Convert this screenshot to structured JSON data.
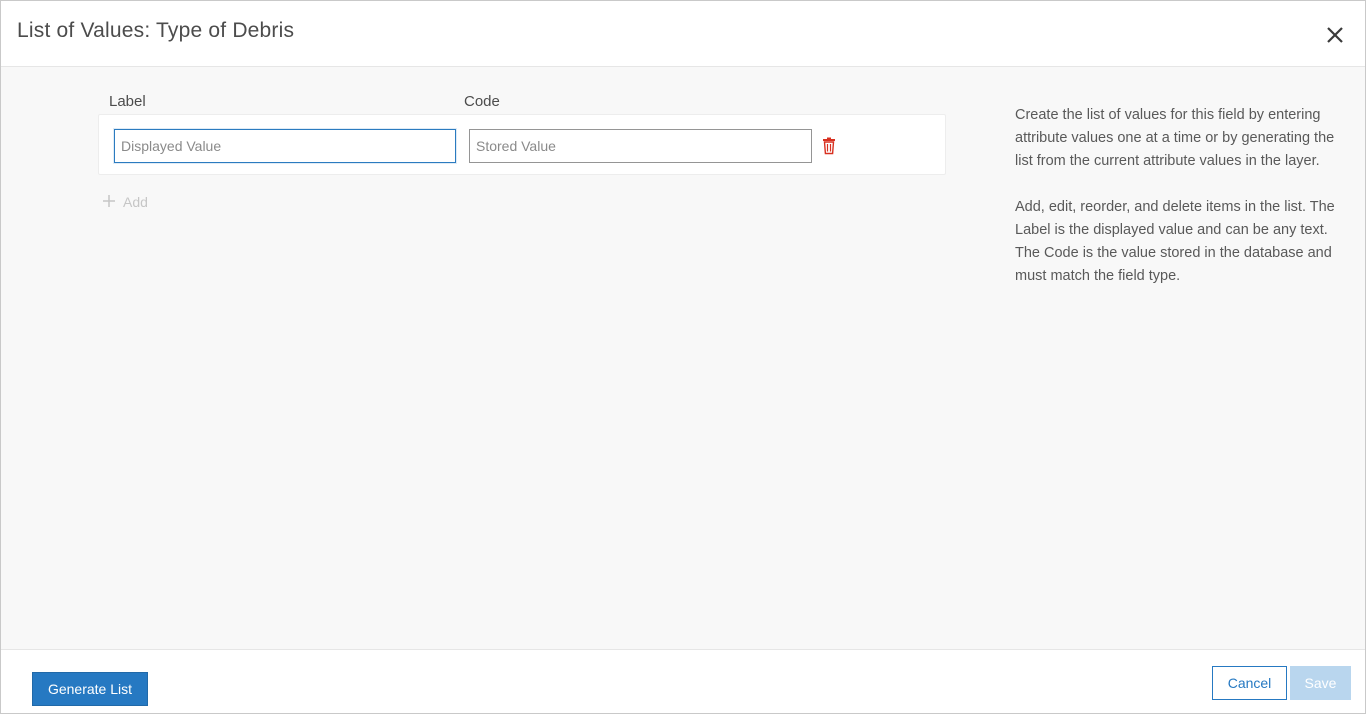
{
  "dialog": {
    "title": "List of Values: Type of Debris",
    "close_icon": "close-icon"
  },
  "table": {
    "columns": {
      "label": "Label",
      "code": "Code"
    },
    "rows": [
      {
        "label_value": "",
        "label_placeholder": "Displayed Value",
        "code_value": "",
        "code_placeholder": "Stored Value",
        "delete_icon": "trash-icon"
      }
    ],
    "add_label": "Add",
    "add_icon": "plus-icon"
  },
  "help": {
    "paragraphs": [
      "Create the list of values for this field by entering attribute values one at a time or by generating the list from the current attribute values in the layer.",
      "Add, edit, reorder, and delete items in the list. The Label is the displayed value and can be any text. The Code is the value stored in the database and must match the field type."
    ]
  },
  "footer": {
    "generate_label": "Generate List",
    "cancel_label": "Cancel",
    "save_label": "Save"
  },
  "colors": {
    "primary": "#2679c2",
    "save_disabled": "#b9d6ee",
    "delete": "#d83020",
    "focus_border": "#2b7bc0"
  }
}
